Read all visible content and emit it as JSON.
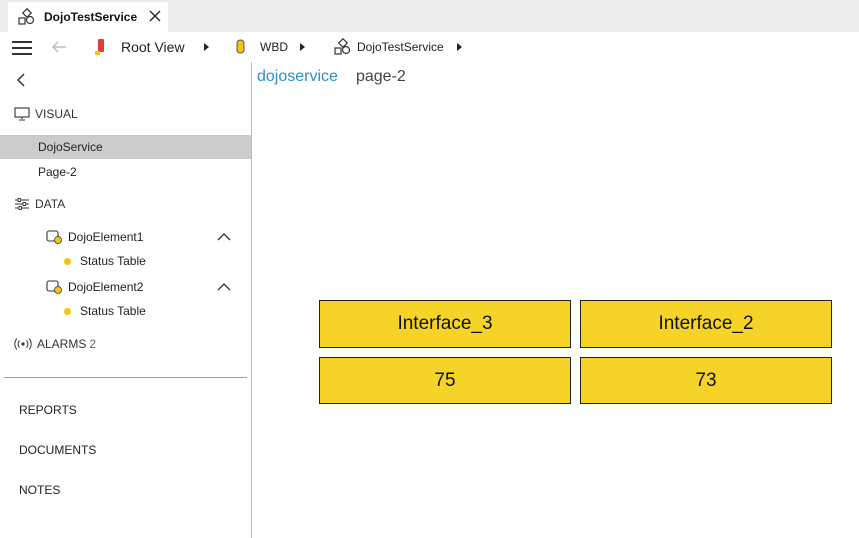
{
  "tab": {
    "title": "DojoTestService",
    "icon": "service-icon",
    "close_icon": "close-icon"
  },
  "toolbar": {
    "menu_icon": "hamburger-icon",
    "back_icon": "arrow-left-icon",
    "breadcrumb": [
      {
        "label": "Root View",
        "icon": "root-view-icon",
        "color": "#e53935"
      },
      {
        "label": "WBD",
        "icon": "wbd-icon",
        "color": "#f0c419"
      },
      {
        "label": "DojoTestService",
        "icon": "service-icon"
      }
    ]
  },
  "sidebar": {
    "back_icon": "chevron-left-icon",
    "visual_header": "VISUAL",
    "visual_items": [
      "DojoService",
      "Page-2"
    ],
    "active_item": "DojoService",
    "data_header": "DATA",
    "data_elements": [
      {
        "label": "DojoElement1",
        "child": "Status Table"
      },
      {
        "label": "DojoElement2",
        "child": "Status Table"
      }
    ],
    "alarms_header": "ALARMS",
    "alarms_count": "2",
    "bottom_links": [
      "REPORTS",
      "DOCUMENTS",
      "NOTES"
    ]
  },
  "main": {
    "breadcrumb_link": "dojoservice",
    "breadcrumb_current": "page-2",
    "grid": {
      "cell_color": "#f5d327",
      "headers": [
        "Interface_3",
        "Interface_2"
      ],
      "values": [
        "75",
        "73"
      ]
    }
  }
}
